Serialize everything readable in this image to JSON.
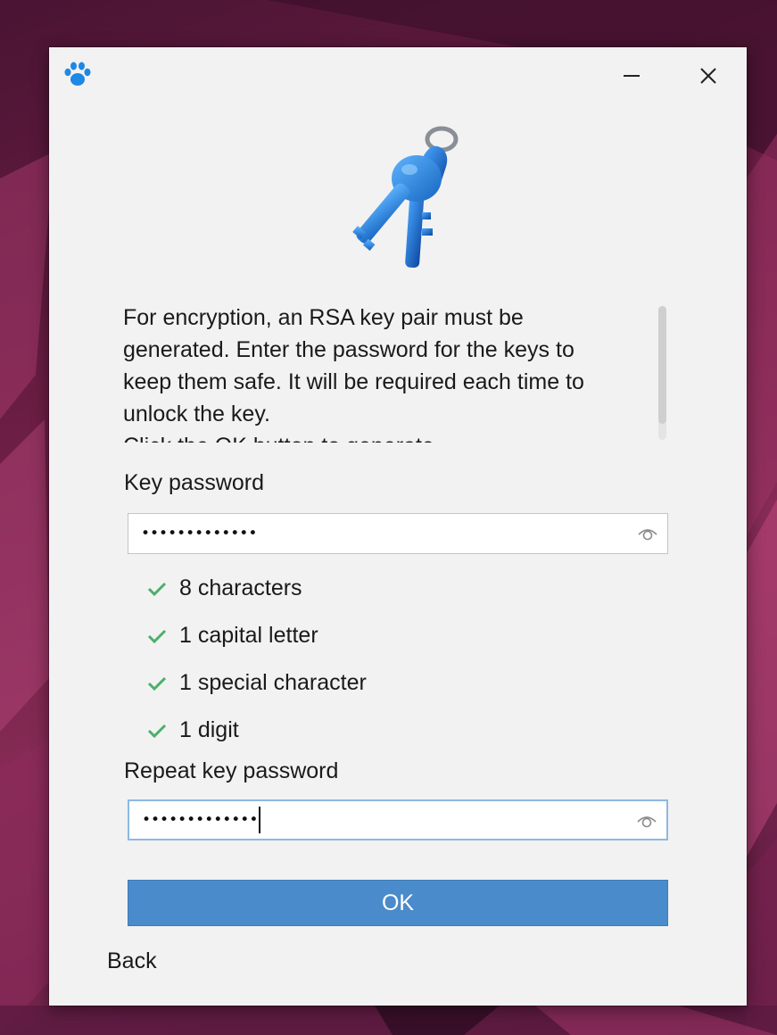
{
  "dialog": {
    "description": "For encryption, an RSA key pair must be\ngenerated. Enter the password for the keys to\nkeep them safe. It will be required each time to\nunlock the key.\nClick the OK button to generate",
    "key_password_label": "Key password",
    "key_password_value": "•••••••••••••",
    "requirements": [
      {
        "label": "8 characters",
        "met": true
      },
      {
        "label": "1 capital letter",
        "met": true
      },
      {
        "label": "1 special character",
        "met": true
      },
      {
        "label": "1 digit",
        "met": true
      }
    ],
    "repeat_password_label": "Repeat key password",
    "repeat_password_value": "•••••••••••••",
    "ok_label": "OK",
    "back_label": "Back"
  },
  "icons": {
    "app": "paw-icon",
    "minimize": "minimize-icon",
    "close": "close-icon",
    "hero": "keys-icon",
    "show_password": "eye-icon",
    "requirement_met": "check-icon"
  },
  "colors": {
    "accent": "#4a8bcb",
    "check": "#4caf6a",
    "paw": "#1e88e5",
    "window_bg": "#f2f2f2"
  }
}
